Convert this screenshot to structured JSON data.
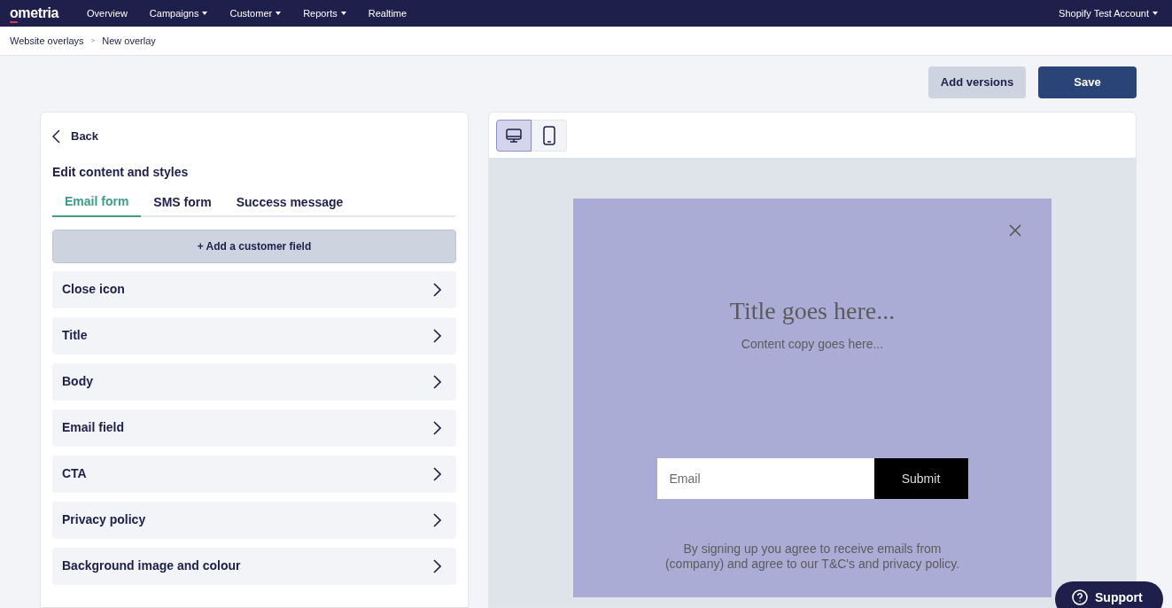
{
  "nav": {
    "logo": "ometria",
    "items": [
      {
        "label": "Overview",
        "has_menu": false
      },
      {
        "label": "Campaigns",
        "has_menu": true
      },
      {
        "label": "Customer",
        "has_menu": true
      },
      {
        "label": "Reports",
        "has_menu": true
      },
      {
        "label": "Realtime",
        "has_menu": false
      }
    ],
    "account": {
      "label": "Shopify Test Account",
      "has_menu": true
    }
  },
  "breadcrumb": {
    "items": [
      "Website overlays",
      "New overlay"
    ],
    "separator": ">"
  },
  "actions": {
    "secondary": "Add versions",
    "primary": "Save"
  },
  "editor": {
    "back": "Back",
    "heading": "Edit content and styles",
    "tabs": [
      {
        "label": "Email form",
        "selected": true
      },
      {
        "label": "SMS form",
        "selected": false
      },
      {
        "label": "Success message",
        "selected": false
      }
    ],
    "add_field": "+ Add a customer field",
    "sections": [
      "Close icon",
      "Title",
      "Body",
      "Email field",
      "CTA",
      "Privacy policy",
      "Background image and colour"
    ]
  },
  "preview": {
    "devices": [
      {
        "kind": "desktop",
        "selected": true
      },
      {
        "kind": "mobile",
        "selected": false
      }
    ],
    "overlay": {
      "title": "Title goes here...",
      "body": "Content copy goes here...",
      "email_placeholder": "Email",
      "submit": "Submit",
      "legal": "By signing up you agree to receive emails from (company) and agree to our T&C's and privacy policy."
    }
  },
  "support": "Support"
}
